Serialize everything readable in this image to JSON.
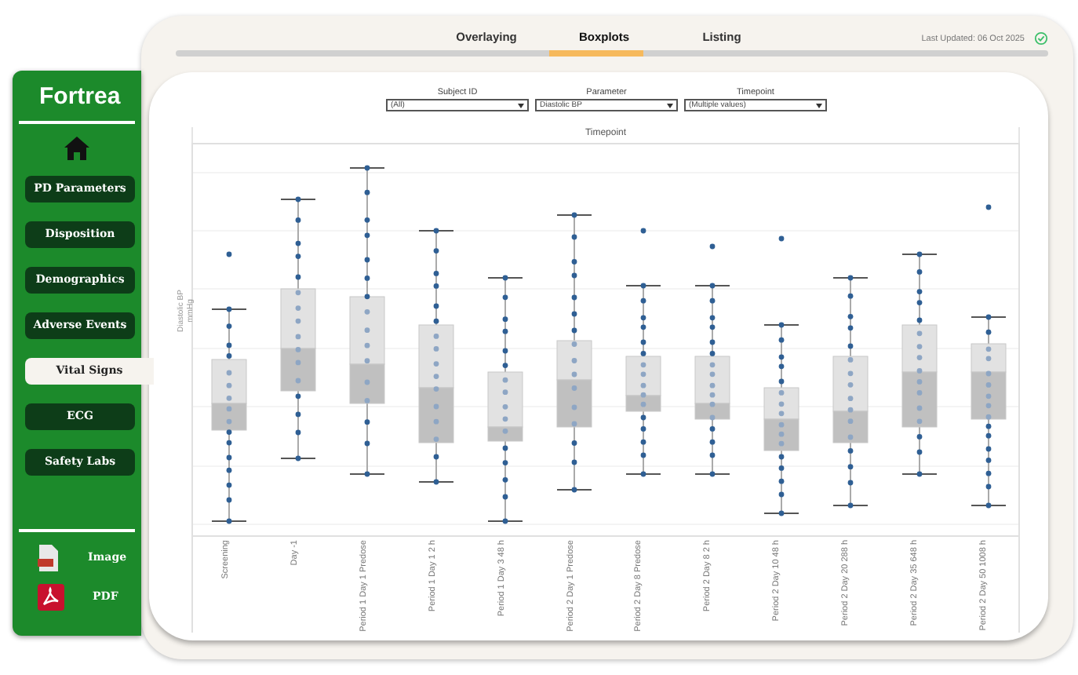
{
  "sidebar": {
    "logo": "Fortrea",
    "nav": [
      {
        "label": "PD Parameters",
        "selected": false
      },
      {
        "label": "Disposition",
        "selected": false
      },
      {
        "label": "Demographics",
        "selected": false
      },
      {
        "label": "Adverse Events",
        "selected": false
      },
      {
        "label": "Vital Signs",
        "selected": true
      },
      {
        "label": "ECG",
        "selected": false
      },
      {
        "label": "Safety Labs",
        "selected": false
      }
    ],
    "exports": [
      {
        "label": "Image",
        "kind": "png"
      },
      {
        "label": "PDF",
        "kind": "pdf"
      }
    ]
  },
  "tabs": [
    {
      "label": "Overlaying",
      "selected": false
    },
    {
      "label": "Boxplots",
      "selected": true
    },
    {
      "label": "Listing",
      "selected": false
    }
  ],
  "last_updated": "Last Updated: 06 Oct 2025",
  "filters": [
    {
      "label": "Subject ID",
      "value": "(All)"
    },
    {
      "label": "Parameter",
      "value": "Diastolic BP"
    },
    {
      "label": "Timepoint",
      "value": "(Multiple values)"
    }
  ],
  "chart": {
    "header": "Timepoint",
    "ylabel": [
      "Diastolic BP",
      "mmHg"
    ],
    "categories": [
      "Screening",
      "Day -1",
      "Period 1 Day 1 Predose",
      "Period 1 Day 1 2 h",
      "Period 1 Day 3 48 h",
      "Period 2 Day 1 Predose",
      "Period 2 Day 8 Predose",
      "Period 2 Day 8 2 h",
      "Period 2 Day 10 48 h",
      "Period 2 Day 20 288 h",
      "Period 2 Day 35 648 h",
      "Period 2 Day 50 1008 h"
    ]
  }
}
